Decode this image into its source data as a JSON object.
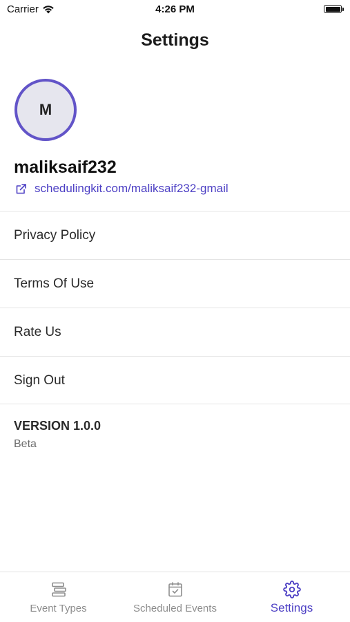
{
  "status_bar": {
    "carrier": "Carrier",
    "time": "4:26 PM"
  },
  "header": {
    "title": "Settings"
  },
  "profile": {
    "initial": "M",
    "username": "maliksaif232",
    "link_text": "schedulingkit.com/maliksaif232-gmail",
    "link_icon": "external-link-icon"
  },
  "menu": {
    "items": [
      {
        "label": "Privacy Policy"
      },
      {
        "label": "Terms Of Use"
      },
      {
        "label": "Rate Us"
      },
      {
        "label": "Sign Out"
      }
    ]
  },
  "version": {
    "label": "VERSION 1.0.0",
    "channel": "Beta"
  },
  "tab_bar": {
    "tabs": [
      {
        "label": "Event Types",
        "icon": "list-icon"
      },
      {
        "label": "Scheduled Events",
        "icon": "calendar-check-icon"
      },
      {
        "label": "Settings",
        "icon": "gear-icon",
        "active": true
      }
    ]
  },
  "colors": {
    "accent": "#4c3fc4",
    "avatar_ring": "#6254c8",
    "avatar_bg": "#e6e6ee",
    "divider": "#e4e4e4",
    "inactive_tab": "#8d8d8d"
  }
}
